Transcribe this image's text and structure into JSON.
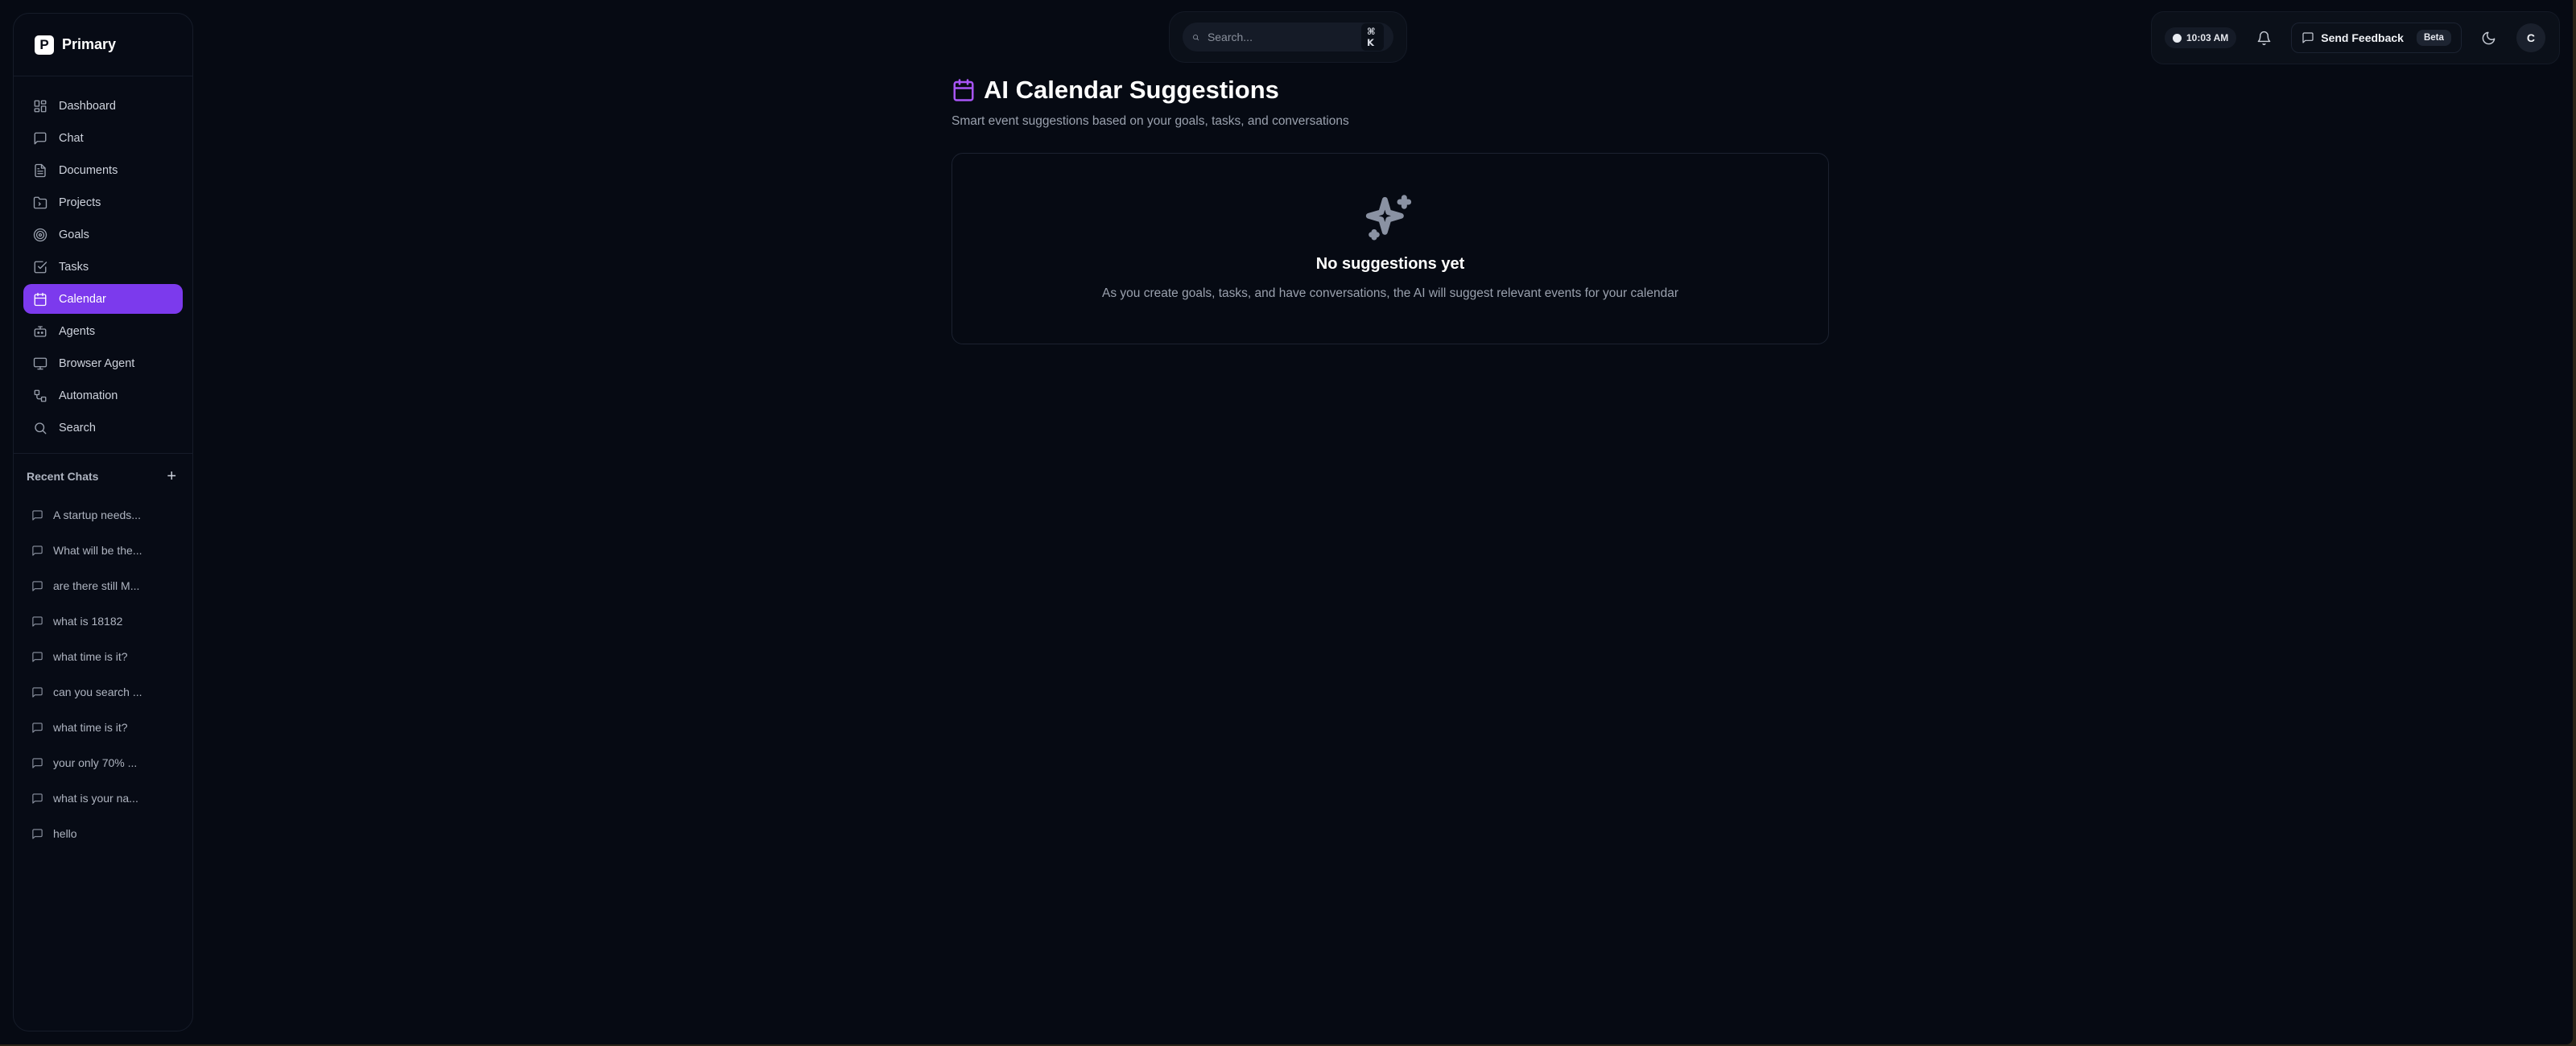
{
  "brand": {
    "logo_letter": "P",
    "name": "Primary"
  },
  "sidebar": {
    "nav": [
      {
        "label": "Dashboard",
        "icon": "dashboard-icon"
      },
      {
        "label": "Chat",
        "icon": "chat-icon"
      },
      {
        "label": "Documents",
        "icon": "document-icon"
      },
      {
        "label": "Projects",
        "icon": "folder-icon"
      },
      {
        "label": "Goals",
        "icon": "target-icon"
      },
      {
        "label": "Tasks",
        "icon": "checkbox-icon"
      },
      {
        "label": "Calendar",
        "icon": "calendar-icon",
        "active": true
      },
      {
        "label": "Agents",
        "icon": "bot-icon"
      },
      {
        "label": "Browser Agent",
        "icon": "monitor-icon"
      },
      {
        "label": "Automation",
        "icon": "workflow-icon"
      },
      {
        "label": "Search",
        "icon": "search-icon"
      }
    ],
    "recent_title": "Recent Chats",
    "recent_add": "+",
    "recent_chats": [
      "A startup needs...",
      "What will be the...",
      "are there still M...",
      "what is 18182",
      "what time is it?",
      "can you search ...",
      "what time is it?",
      "your only 70% ...",
      "what is your na...",
      "hello"
    ]
  },
  "search": {
    "placeholder": "Search...",
    "shortcut": "⌘ K"
  },
  "topbar": {
    "time": "10:03 AM",
    "feedback_label": "Send Feedback",
    "beta_label": "Beta",
    "avatar_letter": "C"
  },
  "main": {
    "title": "AI Calendar Suggestions",
    "subtitle": "Smart event suggestions based on your goals, tasks, and conversations",
    "empty_title": "No suggestions yet",
    "empty_text": "As you create goals, tasks, and have conversations, the AI will suggest relevant events for your calendar"
  },
  "colors": {
    "accent": "#7c3aed",
    "accent_icon": "#a855f7",
    "background": "#060a13",
    "panel": "#0b1019"
  }
}
